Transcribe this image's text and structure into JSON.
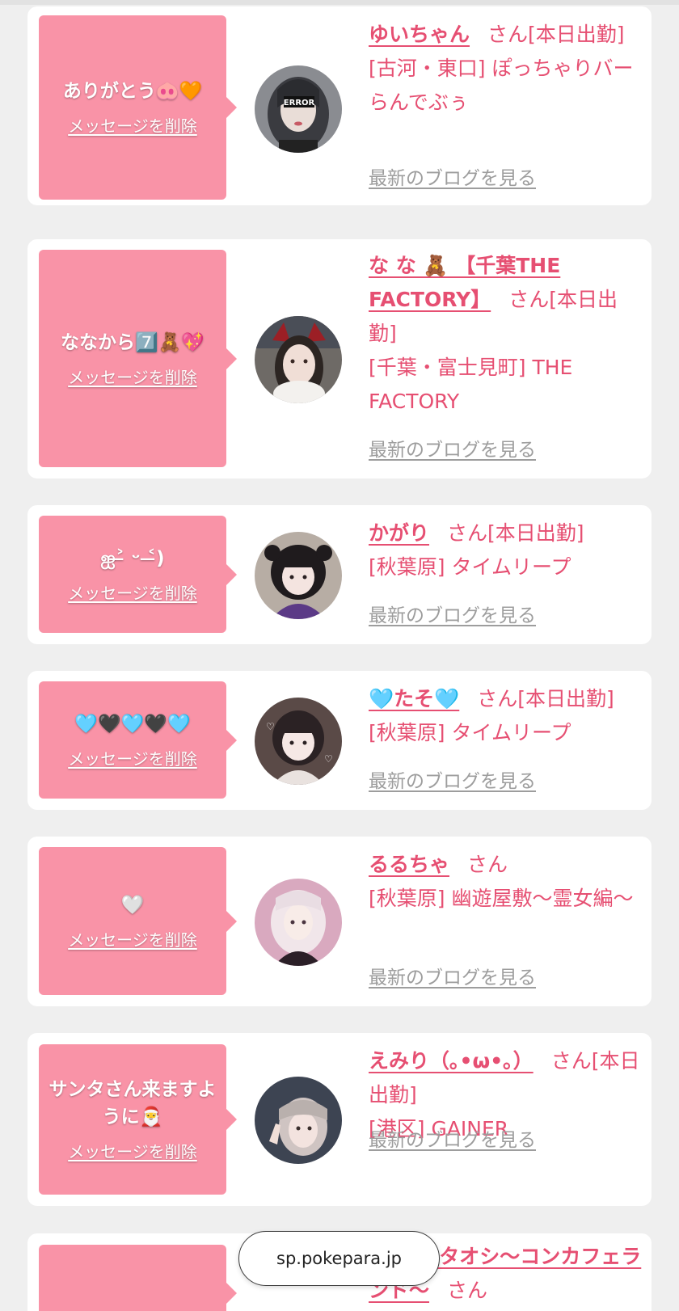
{
  "url_bar": {
    "host": "sp.pokepara.jp"
  },
  "common": {
    "delete_label": "メッセージを削除",
    "blog_label": "最新のブログを見る",
    "san": "さん"
  },
  "cards": [
    {
      "message": "ありがとう🐽🧡",
      "name": "ゆいちゃん",
      "status": "[本日出勤]",
      "shop": "[古河・東口] ぽっちゃりバー らんでぶぅ",
      "avatar_text": "ERROR"
    },
    {
      "message": "ななから7️⃣🧸💖",
      "name": "な な 🧸 【千葉THE FACTORY】",
      "status": "[本日出勤]",
      "shop": "[千葉・富士見町] THE FACTORY"
    },
    {
      "message": "ஐ˃̶ ᵕ ˂̶)",
      "name": "かがり",
      "status": "[本日出勤]",
      "shop": "[秋葉原] タイムリープ"
    },
    {
      "message": "🩵🖤🩵🖤🩵",
      "name": "🩵たそ🩵",
      "status": "[本日出勤]",
      "shop": "[秋葉原] タイムリープ"
    },
    {
      "message": "🤍",
      "name": "るるちゃ",
      "status": "",
      "shop": "[秋葉原] 幽遊屋敷〜霊女編〜"
    },
    {
      "message": "サンタさん来ますように🎅",
      "name": "えみり（｡•ω•｡）",
      "status": "[本日出勤]",
      "shop": "[港区] GAINER"
    },
    {
      "message": "",
      "name": "💗🎠ワタオシ〜コンカフェランド〜",
      "status": "",
      "shop": ""
    }
  ],
  "colors": {
    "accent": "#e64f72",
    "bubble": "#f993a7",
    "link_gray": "#9d9d9d"
  }
}
